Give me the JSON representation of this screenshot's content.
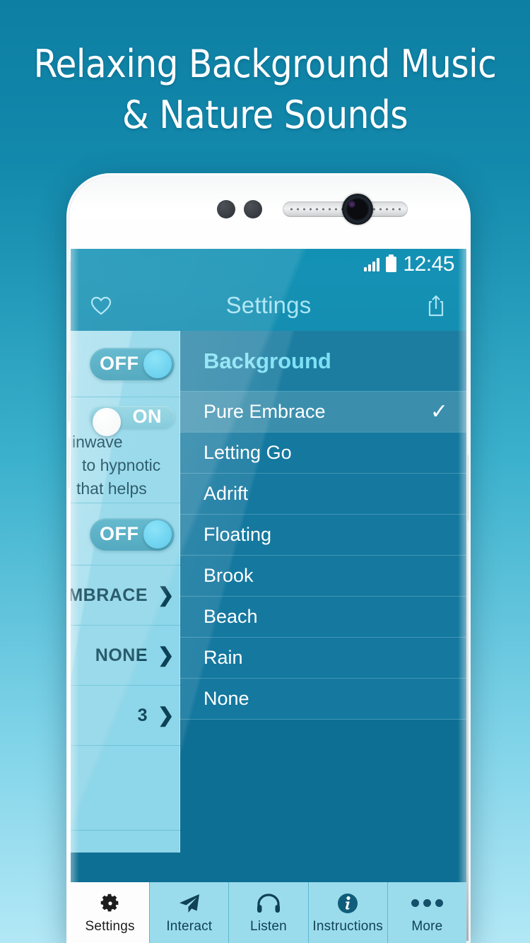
{
  "promo": {
    "line1": "Relaxing Background Music",
    "line2": "& Nature Sounds"
  },
  "statusbar": {
    "time": "12:45",
    "signal_icon": "signal-bars-icon",
    "battery_icon": "battery-full-icon"
  },
  "appbar": {
    "title": "Settings",
    "left_icon": "heart-icon",
    "right_icon": "share-icon"
  },
  "left_panel": {
    "rows": [
      {
        "type": "toggle",
        "state": "OFF"
      },
      {
        "type": "toggle",
        "state": "ON"
      },
      {
        "type": "text",
        "lines": [
          "inwave",
          "to hypnotic",
          "that helps"
        ]
      },
      {
        "type": "toggle",
        "state": "OFF"
      },
      {
        "type": "value",
        "value": "MBRACE",
        "chevron": "❯"
      },
      {
        "type": "value",
        "value": "NONE",
        "chevron": "❯"
      },
      {
        "type": "value",
        "value": "3",
        "chevron": "❯"
      }
    ]
  },
  "background_list": {
    "header": "Background",
    "selected": "Pure Embrace",
    "check_glyph": "✓",
    "items": [
      {
        "label": "Pure Embrace",
        "selected": true
      },
      {
        "label": "Letting Go",
        "selected": false
      },
      {
        "label": "Adrift",
        "selected": false
      },
      {
        "label": "Floating",
        "selected": false
      },
      {
        "label": "Brook",
        "selected": false
      },
      {
        "label": "Beach",
        "selected": false
      },
      {
        "label": "Rain",
        "selected": false
      },
      {
        "label": "None",
        "selected": false
      }
    ]
  },
  "tabbar": {
    "active": "Settings",
    "tabs": [
      {
        "label": "Settings",
        "icon": "gear-icon"
      },
      {
        "label": "Interact",
        "icon": "paper-plane-icon"
      },
      {
        "label": "Listen",
        "icon": "headphones-icon"
      },
      {
        "label": "Instructions",
        "icon": "info-circle-icon"
      },
      {
        "label": "More",
        "icon": "ellipsis-icon"
      }
    ]
  },
  "colors": {
    "bg_top": "#0d7fa3",
    "bg_bottom": "#b3e8f6",
    "appbar": "#1491b4",
    "list_bg": "#14789f",
    "list_selected": "#3b8fad",
    "list_header_text": "#7fe0f5",
    "left_panel": "#8ed6e9",
    "tab_bg": "#9bdcec",
    "tab_active_bg": "#fdfdfd"
  }
}
